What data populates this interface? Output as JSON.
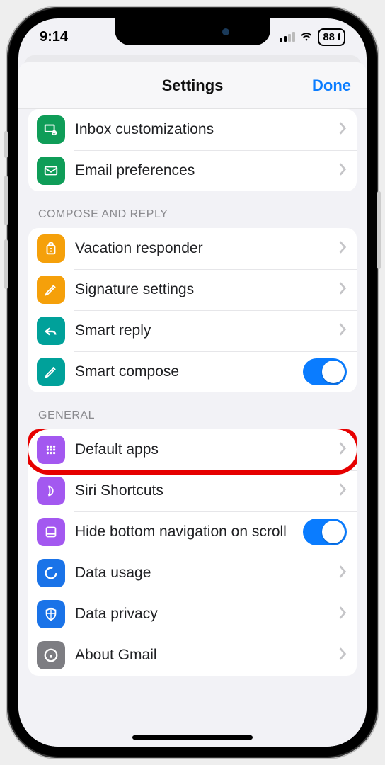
{
  "status": {
    "time": "9:14",
    "battery": "88"
  },
  "nav": {
    "title": "Settings",
    "done": "Done"
  },
  "sections": {
    "top": {
      "inbox": "Inbox customizations",
      "email": "Email preferences"
    },
    "compose": {
      "header": "COMPOSE AND REPLY",
      "vacation": "Vacation responder",
      "signature": "Signature settings",
      "smartreply": "Smart reply",
      "smartcompose": "Smart compose"
    },
    "general": {
      "header": "GENERAL",
      "defaultapps": "Default apps",
      "siri": "Siri Shortcuts",
      "hidebottom": "Hide bottom navigation on scroll",
      "datausage": "Data usage",
      "dataprivacy": "Data privacy",
      "about": "About Gmail"
    }
  }
}
